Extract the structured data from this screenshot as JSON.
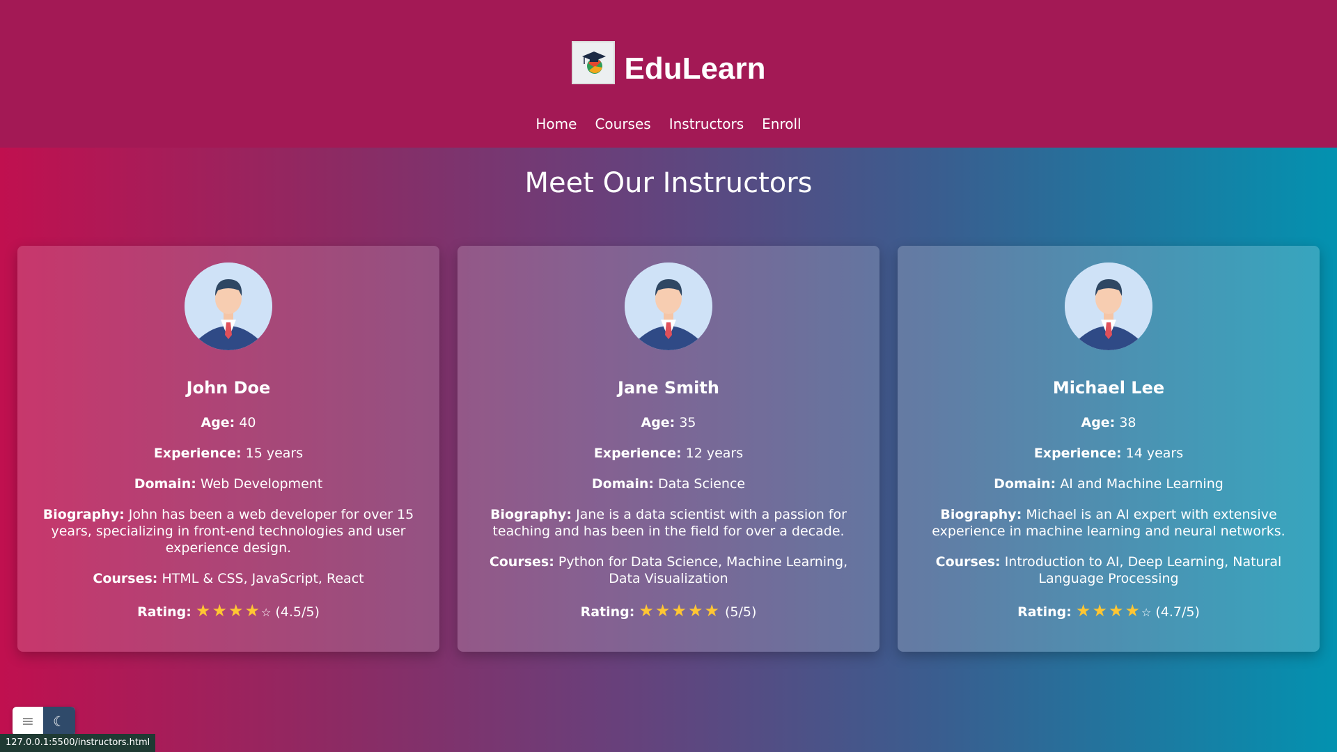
{
  "header": {
    "brand": "EduLearn",
    "logo_icon": "graduation-cap-globe-icon",
    "nav": [
      {
        "label": "Home"
      },
      {
        "label": "Courses"
      },
      {
        "label": "Instructors"
      },
      {
        "label": "Enroll"
      }
    ],
    "background": "#a31955"
  },
  "main": {
    "title": "Meet Our Instructors",
    "instructors": [
      {
        "name": "John Doe",
        "age_label": "Age:",
        "age": "40",
        "experience_label": "Experience:",
        "experience": "15 years",
        "domain_label": "Domain:",
        "domain": "Web Development",
        "biography_label": "Biography:",
        "biography": "John has been a web developer for over 15 years, specializing in front-end technologies and user experience design.",
        "courses_label": "Courses:",
        "courses": "HTML & CSS, JavaScript, React",
        "rating_label": "Rating:",
        "rating_text": "(4.5/5)",
        "rating": 4.5
      },
      {
        "name": "Jane Smith",
        "age_label": "Age:",
        "age": "35",
        "experience_label": "Experience:",
        "experience": "12 years",
        "domain_label": "Domain:",
        "domain": "Data Science",
        "biography_label": "Biography:",
        "biography": "Jane is a data scientist with a passion for teaching and has been in the field for over a decade.",
        "courses_label": "Courses:",
        "courses": "Python for Data Science, Machine Learning, Data Visualization",
        "rating_label": "Rating:",
        "rating_text": "(5/5)",
        "rating": 5
      },
      {
        "name": "Michael Lee",
        "age_label": "Age:",
        "age": "38",
        "experience_label": "Experience:",
        "experience": "14 years",
        "domain_label": "Domain:",
        "domain": "AI and Machine Learning",
        "biography_label": "Biography:",
        "biography": "Michael is an AI expert with extensive experience in machine learning and neural networks.",
        "courses_label": "Courses:",
        "courses": "Introduction to AI, Deep Learning, Natural Language Processing",
        "rating_label": "Rating:",
        "rating_text": "(4.7/5)",
        "rating": 4.7
      }
    ]
  },
  "widgets": {
    "menu_icon": "hamburger-icon",
    "theme_icon": "moon-icon"
  },
  "status_bar": {
    "url": "127.0.0.1:5500/instructors.html"
  }
}
